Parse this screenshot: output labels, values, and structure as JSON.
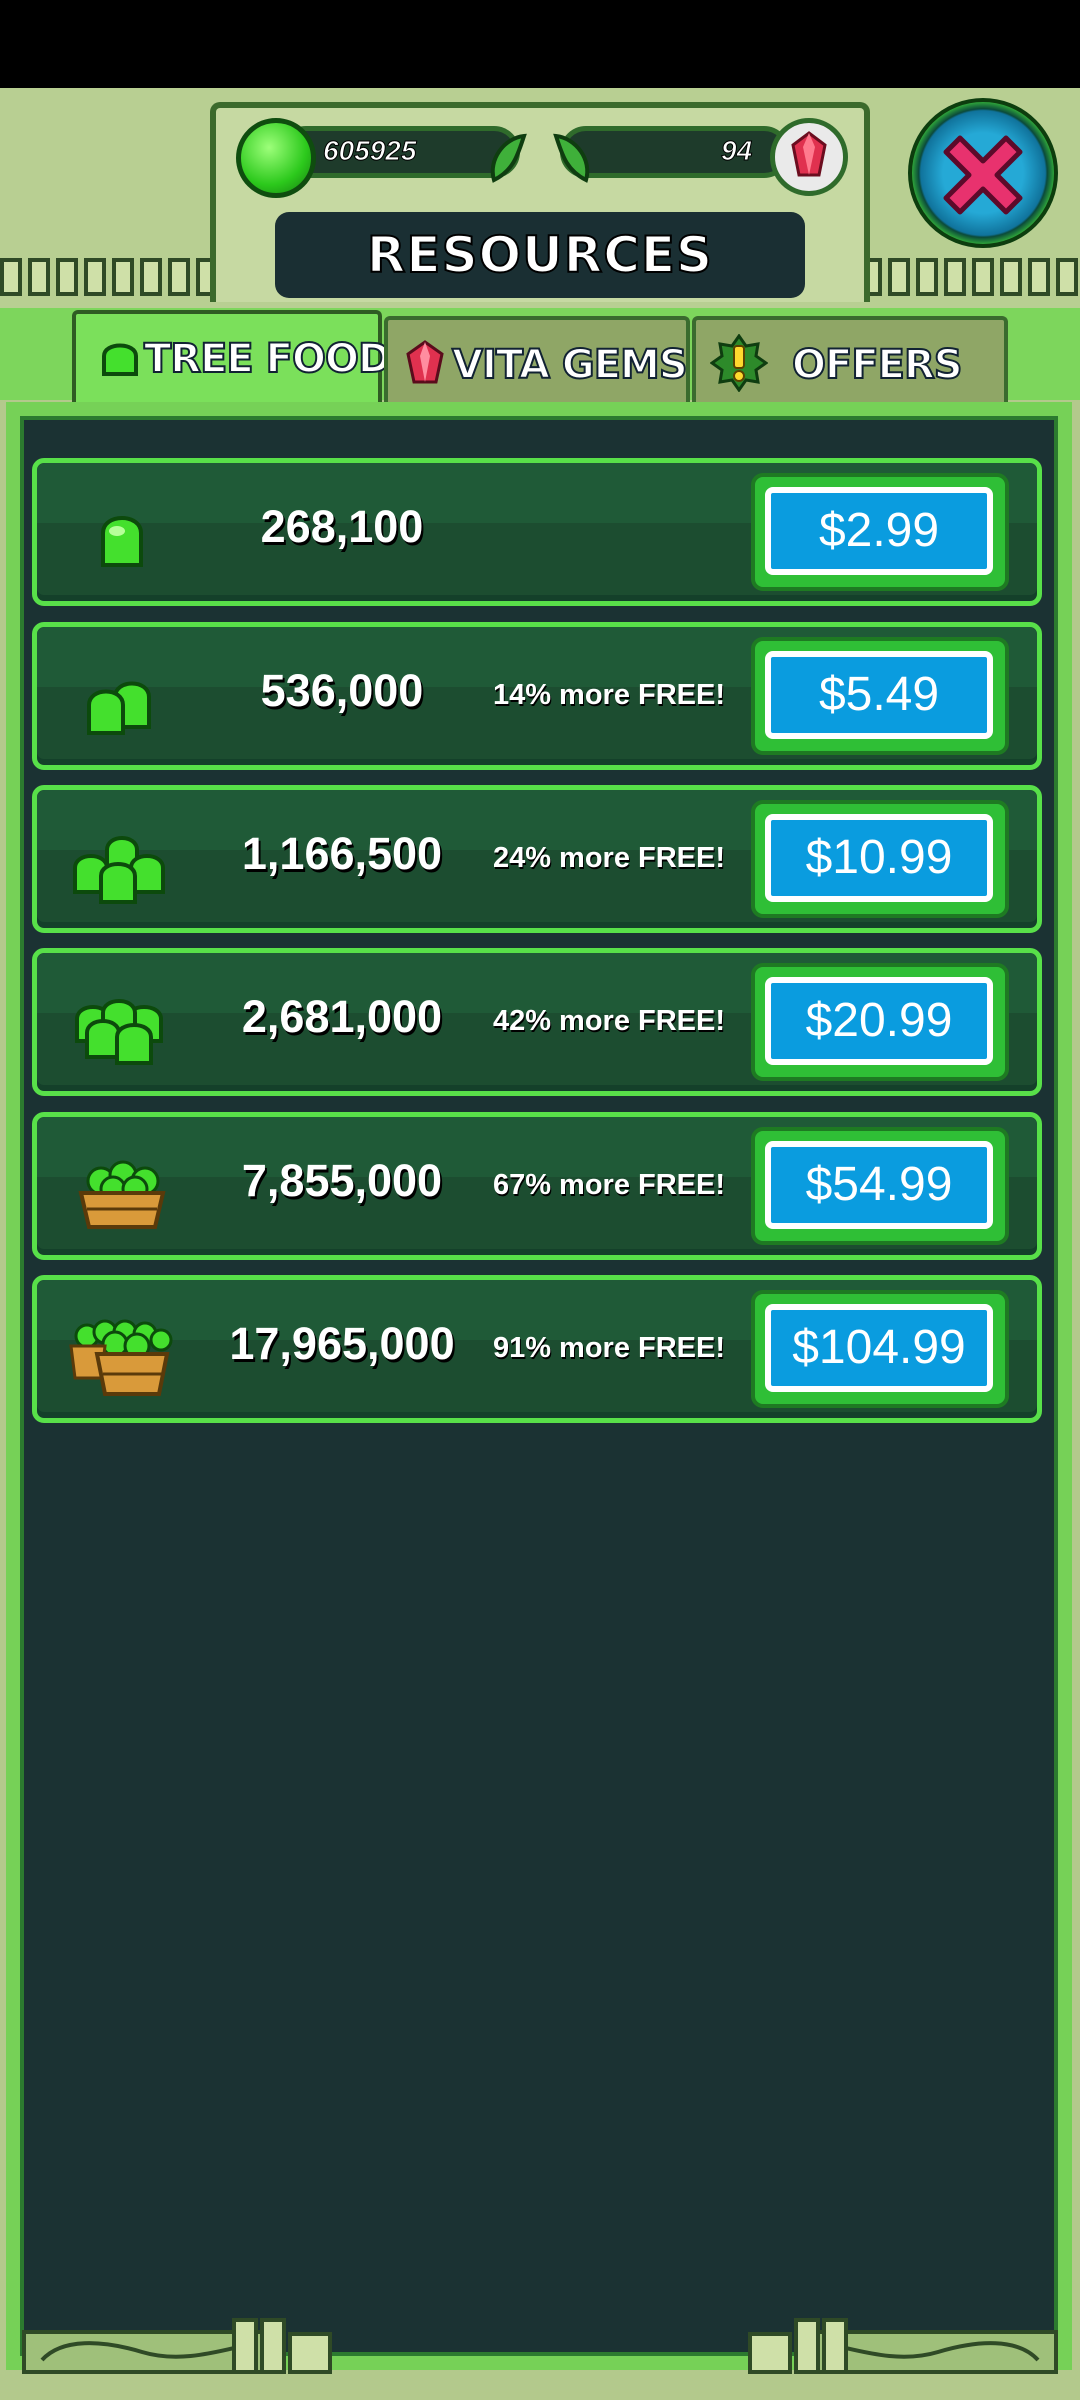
{
  "header": {
    "title": "RESOURCES",
    "food_count": "605925",
    "gem_count": "94"
  },
  "tabs": [
    {
      "label": "TREE FOOD",
      "icon": "food-icon",
      "active": true
    },
    {
      "label": "VITA GEMS",
      "icon": "gem-icon",
      "active": false
    },
    {
      "label": "OFFERS",
      "icon": "exclamation-icon",
      "active": false
    }
  ],
  "offers": [
    {
      "amount": "268,100",
      "bonus": "",
      "price": "$2.99",
      "icon": "food-single-icon"
    },
    {
      "amount": "536,000",
      "bonus": "14% more FREE!",
      "price": "$5.49",
      "icon": "food-pair-icon"
    },
    {
      "amount": "1,166,500",
      "bonus": "24% more FREE!",
      "price": "$10.99",
      "icon": "food-pile-icon"
    },
    {
      "amount": "2,681,000",
      "bonus": "42% more FREE!",
      "price": "$20.99",
      "icon": "food-heap-icon"
    },
    {
      "amount": "7,855,000",
      "bonus": "67% more FREE!",
      "price": "$54.99",
      "icon": "food-crate-icon"
    },
    {
      "amount": "17,965,000",
      "bonus": "91% more FREE!",
      "price": "$104.99",
      "icon": "food-crates-icon"
    }
  ],
  "colors": {
    "panel_bg": "#1b3233",
    "row_bg": "#1c4d30",
    "price_blue": "#0a9cdf",
    "accent_green": "#58e049"
  }
}
